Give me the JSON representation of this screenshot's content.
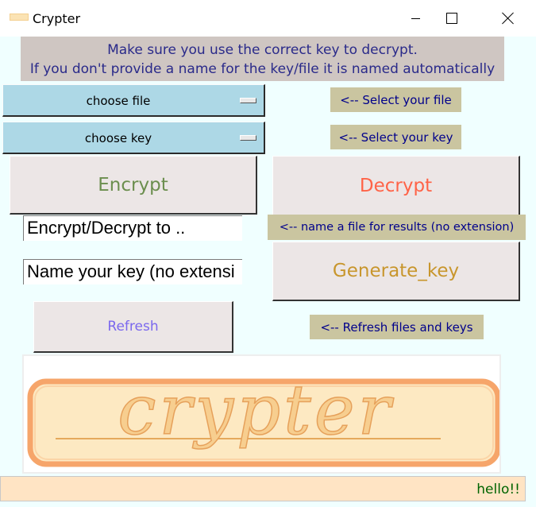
{
  "window": {
    "title": "Crypter",
    "minimize_icon": "minimize-icon",
    "maximize_icon": "maximize-icon",
    "close_icon": "close-icon"
  },
  "banner": {
    "line1": "Make sure you use the correct key to decrypt.",
    "line2": "If you don't provide a name for  the key/file it is named automatically"
  },
  "file_select": {
    "value": "choose file",
    "hint": "<-- Select your file"
  },
  "key_select": {
    "value": "choose key",
    "hint": "<-- Select your key"
  },
  "buttons": {
    "encrypt": "Encrypt",
    "decrypt": "Decrypt",
    "generate_key": "Generate_key",
    "refresh": "Refresh"
  },
  "result_name": {
    "value": "Encrypt/Decrypt to ..",
    "hint": "<-- name a file for results (no extension)"
  },
  "key_name": {
    "value": "Name your key (no extensi"
  },
  "refresh_hint": "<-- Refresh files and keys",
  "logo": {
    "text": "crypter"
  },
  "status": {
    "text": "hello!!"
  },
  "colors": {
    "client_bg": "#f0ffff",
    "dropdown_bg": "#add8e6",
    "tag_bg": "#cac5a0",
    "tag_text": "#00008b",
    "encrypt_text": "#6b8e4e",
    "decrypt_text": "#ff6347",
    "generate_text": "#c8962d",
    "refresh_text": "#7b68ee",
    "logo_orange": "#f4a460",
    "logo_fill": "#fde9c2",
    "status_bg": "#ffe4c4",
    "status_text": "#006400"
  }
}
